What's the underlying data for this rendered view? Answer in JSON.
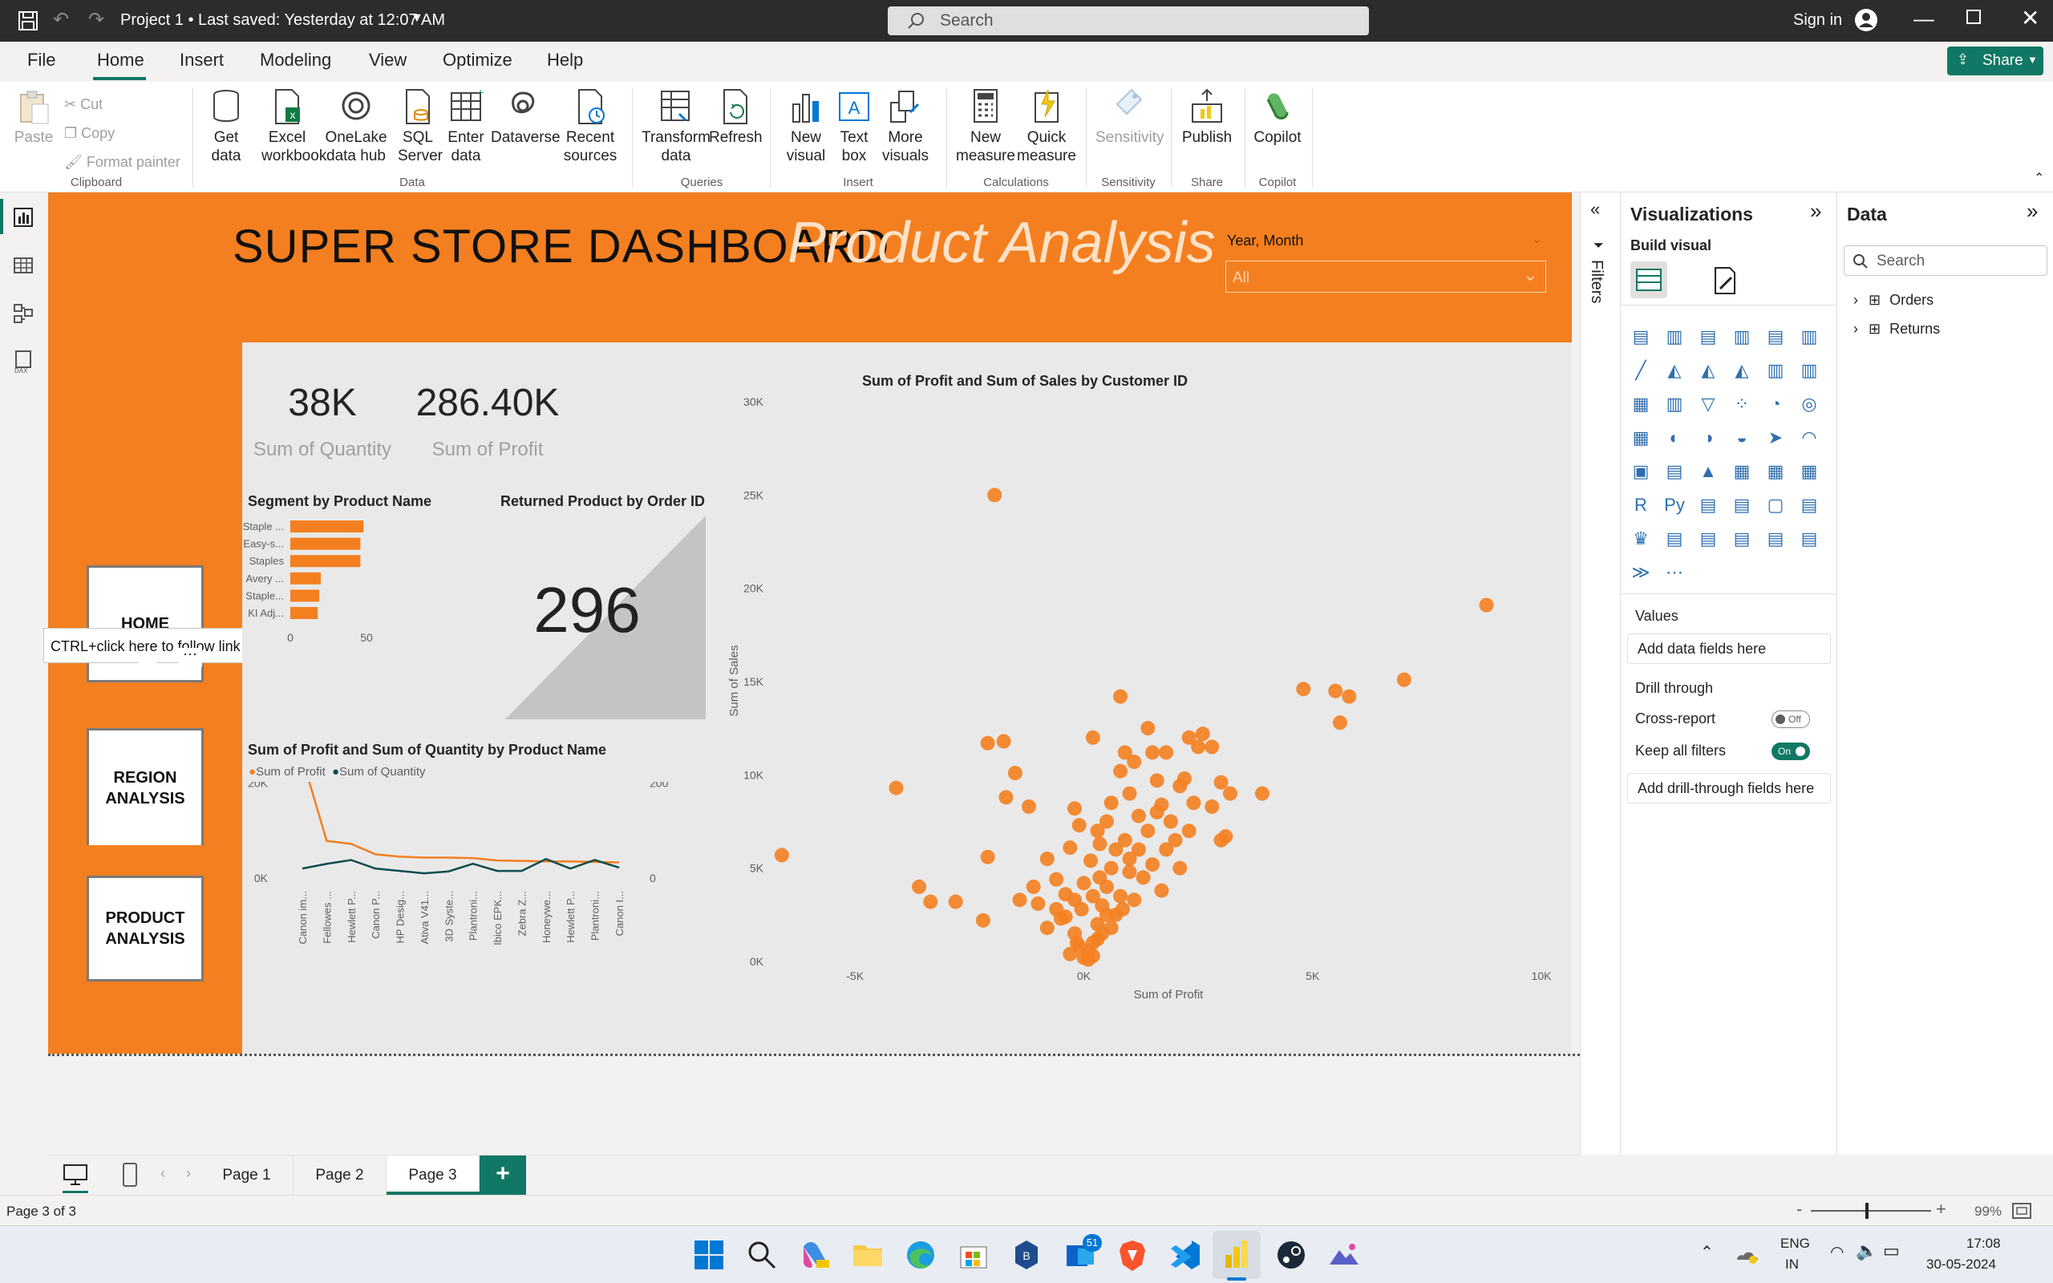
{
  "titlebar": {
    "project_title": "Project 1 • Last saved: Yesterday at 12:07 AM",
    "search_placeholder": "Search",
    "sign_in": "Sign in"
  },
  "menu": {
    "items": [
      "File",
      "Home",
      "Insert",
      "Modeling",
      "View",
      "Optimize",
      "Help"
    ],
    "active": "Home",
    "share_label": "Share"
  },
  "ribbon": {
    "clipboard": {
      "paste": "Paste",
      "cut": "Cut",
      "copy": "Copy",
      "format_painter": "Format painter",
      "group": "Clipboard"
    },
    "data": {
      "get_data": "Get data",
      "excel": "Excel workbook",
      "onelake": "OneLake data hub",
      "sql": "SQL Server",
      "enter": "Enter data",
      "dataverse": "Dataverse",
      "recent": "Recent sources",
      "group": "Data"
    },
    "queries": {
      "transform": "Transform data",
      "refresh": "Refresh",
      "group": "Queries"
    },
    "insert": {
      "new_visual": "New visual",
      "text_box": "Text box",
      "more_visuals": "More visuals",
      "group": "Insert"
    },
    "calculations": {
      "new_measure": "New measure",
      "quick_measure": "Quick measure",
      "group": "Calculations"
    },
    "sensitivity": {
      "label": "Sensitivity",
      "group": "Sensitivity"
    },
    "share": {
      "publish": "Publish",
      "group": "Share"
    },
    "copilot": {
      "label": "Copilot",
      "group": "Copilot"
    }
  },
  "report": {
    "title": "SUPER STORE  DASHBOARD",
    "subtitle": "Product Analysis",
    "slicer_label": "Year, Month",
    "slicer_value": "All",
    "nav": {
      "home": "HOME",
      "region": "REGION ANALYSIS",
      "product": "PRODUCT ANALYSIS"
    },
    "tooltip": "CTRL+click here to follow link",
    "cards": [
      {
        "value": "38K",
        "label": "Sum of Quantity"
      },
      {
        "value": "286.40K",
        "label": "Sum of Profit"
      }
    ],
    "returned": {
      "title": "Returned Product by Order ID",
      "value": "296"
    }
  },
  "chart_data": [
    {
      "type": "bar",
      "title": "Segment by Product Name",
      "categories": [
        "Staple ...",
        "Easy-s...",
        "Staples",
        "Avery ...",
        "Staple...",
        "KI Adj..."
      ],
      "values": [
        48,
        46,
        46,
        20,
        19,
        18
      ],
      "xlim": [
        0,
        50
      ],
      "xticks": [
        "0",
        "50"
      ]
    },
    {
      "type": "line",
      "title": "Sum of Profit and Sum of Quantity by Product Name",
      "legend": [
        "Sum of Profit",
        "Sum of Quantity"
      ],
      "categories": [
        "Canon im...",
        "Fellowes ...",
        "Hewlett P...",
        "Canon P...",
        "HP Desig...",
        "Ativa V41...",
        "3D Syste...",
        "Plantroni...",
        "Ibico EPK...",
        "Zebra Z...",
        "Honeywe...",
        "Hewlett P...",
        "Plantroni...",
        "Canon I..."
      ],
      "series": [
        {
          "name": "Sum of Profit",
          "values": [
            25200,
            7800,
            7200,
            5000,
            4500,
            4300,
            4300,
            4200,
            3700,
            3600,
            3500,
            3500,
            3400,
            3300
          ]
        },
        {
          "name": "Sum of Quantity",
          "values": [
            20,
            30,
            38,
            20,
            15,
            10,
            14,
            30,
            15,
            15,
            40,
            20,
            38,
            22
          ]
        }
      ],
      "yticks_left": [
        "0K",
        "20K"
      ],
      "yticks_right": [
        "0",
        "200"
      ],
      "ylim_left": [
        0,
        27000
      ],
      "ylim_right": [
        0,
        270
      ]
    },
    {
      "type": "scatter",
      "title": "Sum of Profit and Sum of Sales by Customer ID",
      "xlabel": "Sum of Profit",
      "ylabel": "Sum of Sales",
      "xlim": [
        -6300,
        10000
      ],
      "ylim": [
        0,
        30000
      ],
      "xticks": [
        "-5K",
        "0K",
        "5K",
        "10K"
      ],
      "yticks": [
        "0K",
        "5K",
        "10K",
        "15K",
        "20K",
        "25K",
        "30K"
      ],
      "points": [
        [
          -6600,
          5700
        ],
        [
          -1950,
          25000
        ],
        [
          -4100,
          9300
        ],
        [
          -3600,
          4000
        ],
        [
          -3350,
          3200
        ],
        [
          -2800,
          3200
        ],
        [
          -2200,
          2200
        ],
        [
          -2100,
          5600
        ],
        [
          -2100,
          11700
        ],
        [
          -1750,
          11800
        ],
        [
          -1700,
          8800
        ],
        [
          -1500,
          10100
        ],
        [
          -1400,
          3300
        ],
        [
          -1100,
          4000
        ],
        [
          -800,
          5500
        ],
        [
          -1000,
          3100
        ],
        [
          -1200,
          8300
        ],
        [
          -600,
          4400
        ],
        [
          -500,
          2300
        ],
        [
          -800,
          1800
        ],
        [
          -600,
          2800
        ],
        [
          -400,
          3600
        ],
        [
          -300,
          6100
        ],
        [
          -200,
          8200
        ],
        [
          -100,
          7300
        ],
        [
          200,
          12000
        ],
        [
          200,
          3500
        ],
        [
          350,
          4500
        ],
        [
          800,
          14200
        ],
        [
          800,
          10200
        ],
        [
          900,
          11200
        ],
        [
          1100,
          10700
        ],
        [
          1200,
          7800
        ],
        [
          1400,
          12500
        ],
        [
          1500,
          11200
        ],
        [
          1600,
          9700
        ],
        [
          1700,
          8400
        ],
        [
          1800,
          11200
        ],
        [
          2000,
          6500
        ],
        [
          2100,
          5000
        ],
        [
          2200,
          9800
        ],
        [
          2300,
          12000
        ],
        [
          2500,
          11500
        ],
        [
          2600,
          12200
        ],
        [
          2800,
          8300
        ],
        [
          3000,
          6500
        ],
        [
          2800,
          11500
        ],
        [
          3100,
          6700
        ],
        [
          3000,
          9600
        ],
        [
          3200,
          9000
        ],
        [
          3900,
          9000
        ],
        [
          4800,
          14600
        ],
        [
          5500,
          14500
        ],
        [
          5800,
          14200
        ],
        [
          5600,
          12800
        ],
        [
          7000,
          15100
        ],
        [
          8800,
          19100
        ],
        [
          500,
          4000
        ],
        [
          600,
          5000
        ],
        [
          700,
          6000
        ],
        [
          400,
          3000
        ],
        [
          300,
          2000
        ],
        [
          200,
          1000
        ],
        [
          100,
          500
        ],
        [
          0,
          200
        ],
        [
          -100,
          800
        ],
        [
          -200,
          1500
        ],
        [
          300,
          7000
        ],
        [
          500,
          7500
        ],
        [
          600,
          8500
        ],
        [
          900,
          6500
        ],
        [
          1000,
          5500
        ],
        [
          1200,
          6000
        ],
        [
          800,
          3500
        ],
        [
          700,
          2500
        ],
        [
          400,
          1500
        ],
        [
          1300,
          4500
        ],
        [
          1500,
          5200
        ],
        [
          1800,
          6000
        ],
        [
          1400,
          7000
        ],
        [
          1900,
          7500
        ],
        [
          2300,
          7000
        ],
        [
          2400,
          8500
        ],
        [
          1700,
          3800
        ],
        [
          1000,
          4800
        ],
        [
          1100,
          3300
        ],
        [
          600,
          1800
        ],
        [
          -300,
          400
        ],
        [
          100,
          100
        ],
        [
          200,
          300
        ],
        [
          -400,
          2400
        ],
        [
          -200,
          3300
        ],
        [
          0,
          4200
        ],
        [
          150,
          5400
        ],
        [
          350,
          6300
        ],
        [
          -50,
          2800
        ],
        [
          500,
          2500
        ],
        [
          850,
          2800
        ],
        [
          300,
          1200
        ],
        [
          -150,
          1000
        ],
        [
          1000,
          9000
        ],
        [
          1600,
          8000
        ],
        [
          2100,
          9400
        ]
      ]
    }
  ],
  "filters_label": "Filters",
  "viz_pane": {
    "title": "Visualizations",
    "build_visual": "Build visual",
    "values_label": "Values",
    "values_placeholder": "Add data fields here",
    "drill_label": "Drill through",
    "cross_report": "Cross-report",
    "cross_state": "Off",
    "keep_filters": "Keep all filters",
    "keep_state": "On",
    "drill_placeholder": "Add drill-through fields here"
  },
  "data_pane": {
    "title": "Data",
    "search_placeholder": "Search",
    "tables": [
      "Orders",
      "Returns"
    ]
  },
  "pages": {
    "tabs": [
      "Page 1",
      "Page 2",
      "Page 3"
    ],
    "active": "Page 3"
  },
  "status": {
    "page_info": "Page 3 of 3",
    "zoom": "99%"
  },
  "taskbar": {
    "lang": "ENG",
    "region": "IN",
    "time": "17:08",
    "date": "30-05-2024",
    "badge": "51"
  },
  "colors": {
    "accent": "#f47f20",
    "series2": "#0e4c4f",
    "brand": "#117865"
  }
}
